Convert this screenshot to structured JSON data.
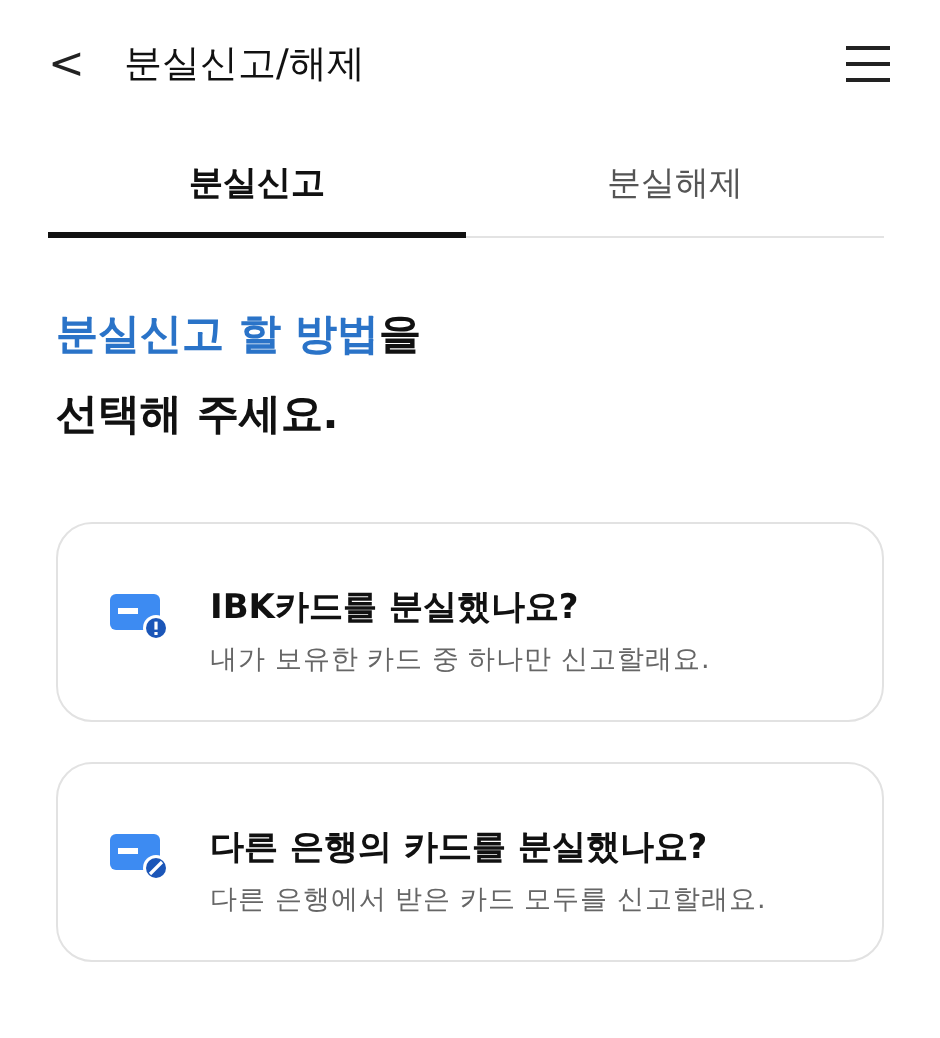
{
  "header": {
    "back": "<",
    "title": "분실신고/해제"
  },
  "tabs": [
    {
      "label": "분실신고",
      "selected": true
    },
    {
      "label": "분실해제",
      "selected": false
    }
  ],
  "heading": {
    "highlight": "분실신고 할 방법",
    "rest": "을",
    "line2": "선택해 주세요."
  },
  "options": [
    {
      "kind": "alert",
      "title": "IBK카드를 분실했나요?",
      "description": "내가 보유한 카드 중 하나만 신고할래요."
    },
    {
      "kind": "blocked",
      "title": "다른 은행의 카드를 분실했나요?",
      "description": "다른 은행에서 받은 카드 모두를 신고할래요."
    }
  ]
}
